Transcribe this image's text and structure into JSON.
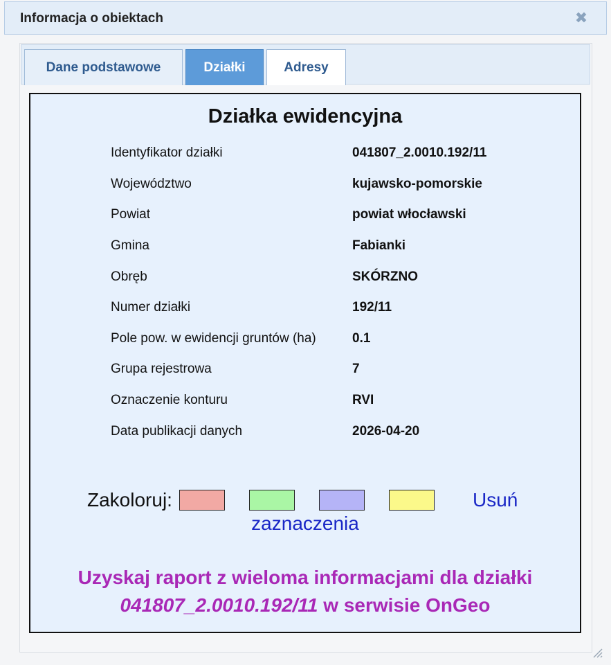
{
  "dialog": {
    "title": "Informacja o obiektach",
    "close_label": "✖"
  },
  "tabs": [
    {
      "label": "Dane podstawowe",
      "active": false
    },
    {
      "label": "Działki",
      "active": true
    },
    {
      "label": "Adresy",
      "active": false
    }
  ],
  "parcel": {
    "heading": "Działka ewidencyjna",
    "rows": [
      {
        "label": "Identyfikator działki",
        "value": "041807_2.0010.192/11"
      },
      {
        "label": "Województwo",
        "value": "kujawsko-pomorskie"
      },
      {
        "label": "Powiat",
        "value": "powiat włocławski"
      },
      {
        "label": "Gmina",
        "value": "Fabianki"
      },
      {
        "label": "Obręb",
        "value": "SKÓRZNO"
      },
      {
        "label": "Numer działki",
        "value": "192/11"
      },
      {
        "label": "Pole pow. w ewidencji gruntów (ha)",
        "value": "0.1"
      },
      {
        "label": "Grupa rejestrowa",
        "value": "7"
      },
      {
        "label": "Oznaczenie konturu",
        "value": "RVI"
      },
      {
        "label": "Data publikacji danych",
        "value": "2026-04-20"
      }
    ]
  },
  "colorize": {
    "label": "Zakoloruj:",
    "swatches": [
      "#f2a9a4",
      "#aaf6a5",
      "#b5b4f7",
      "#fbf98a"
    ],
    "remove_part1": "Usuń",
    "remove_part2": "zaznaczenia"
  },
  "report": {
    "line1": "Uzyskaj raport z wieloma informacjami dla działki",
    "parcel_id": "041807_2.0010.192/11",
    "line2_suffix": " w serwisie OnGeo"
  }
}
